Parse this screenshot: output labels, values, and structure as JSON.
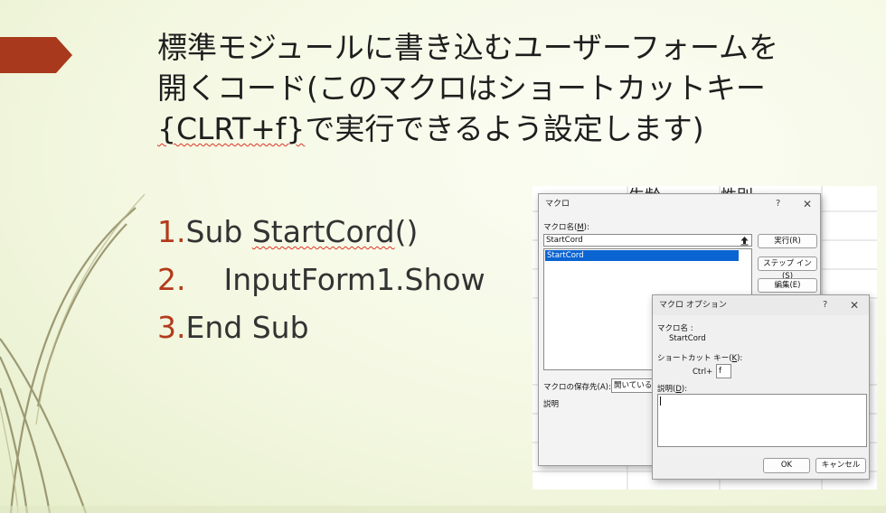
{
  "slide": {
    "title_lines": [
      "標準モジュールに書き込むユーザーフォームを",
      "開くコード(このマクロはショートカットキー"
    ],
    "title_line3_underlined": "{CLRT+f}",
    "title_line3_rest": "で実行できるよう設定します)",
    "code_lines": [
      {
        "num": "1.",
        "pre": "Sub ",
        "underlined": "StartCord",
        "post": "()"
      },
      {
        "num": "2.",
        "pre": "    InputForm1.Show",
        "underlined": "",
        "post": ""
      },
      {
        "num": "3.",
        "pre": "End Sub",
        "underlined": "",
        "post": ""
      }
    ]
  },
  "sheet": {
    "header_1": "生齢",
    "header_2": "性別"
  },
  "macro_dialog": {
    "title": "マクロ",
    "help_label": "?",
    "close_label": "✕",
    "name_label_prefix": "マクロ名(",
    "name_label_key": "M",
    "name_label_suffix": "):",
    "name_value": "StartCord",
    "list_items": [
      "StartCord"
    ],
    "run_button": "実行(R)",
    "step_into_button": "ステップ イン(S)",
    "edit_button": "編集(E)",
    "store_label": "マクロの保存先(A):",
    "store_value": "開いているす",
    "description_label": "説明"
  },
  "options_dialog": {
    "title": "マクロ オプション",
    "help_label": "?",
    "close_label": "✕",
    "macro_name_label": "マクロ名 :",
    "macro_name_value": "StartCord",
    "shortcut_label_prefix": "ショートカット キー(",
    "shortcut_label_key": "K",
    "shortcut_label_suffix": "):",
    "ctrl_label": "Ctrl+",
    "shortcut_value": "f",
    "description_label_prefix": "説明(",
    "description_label_key": "D",
    "description_label_suffix": "):",
    "description_value": "",
    "ok_button": "OK",
    "cancel_button": "キャンセル"
  },
  "colors": {
    "accent": "#a8391c",
    "number_red": "#b33a1c",
    "selection_blue": "#0a64d2",
    "background": "#f4f8e2"
  }
}
